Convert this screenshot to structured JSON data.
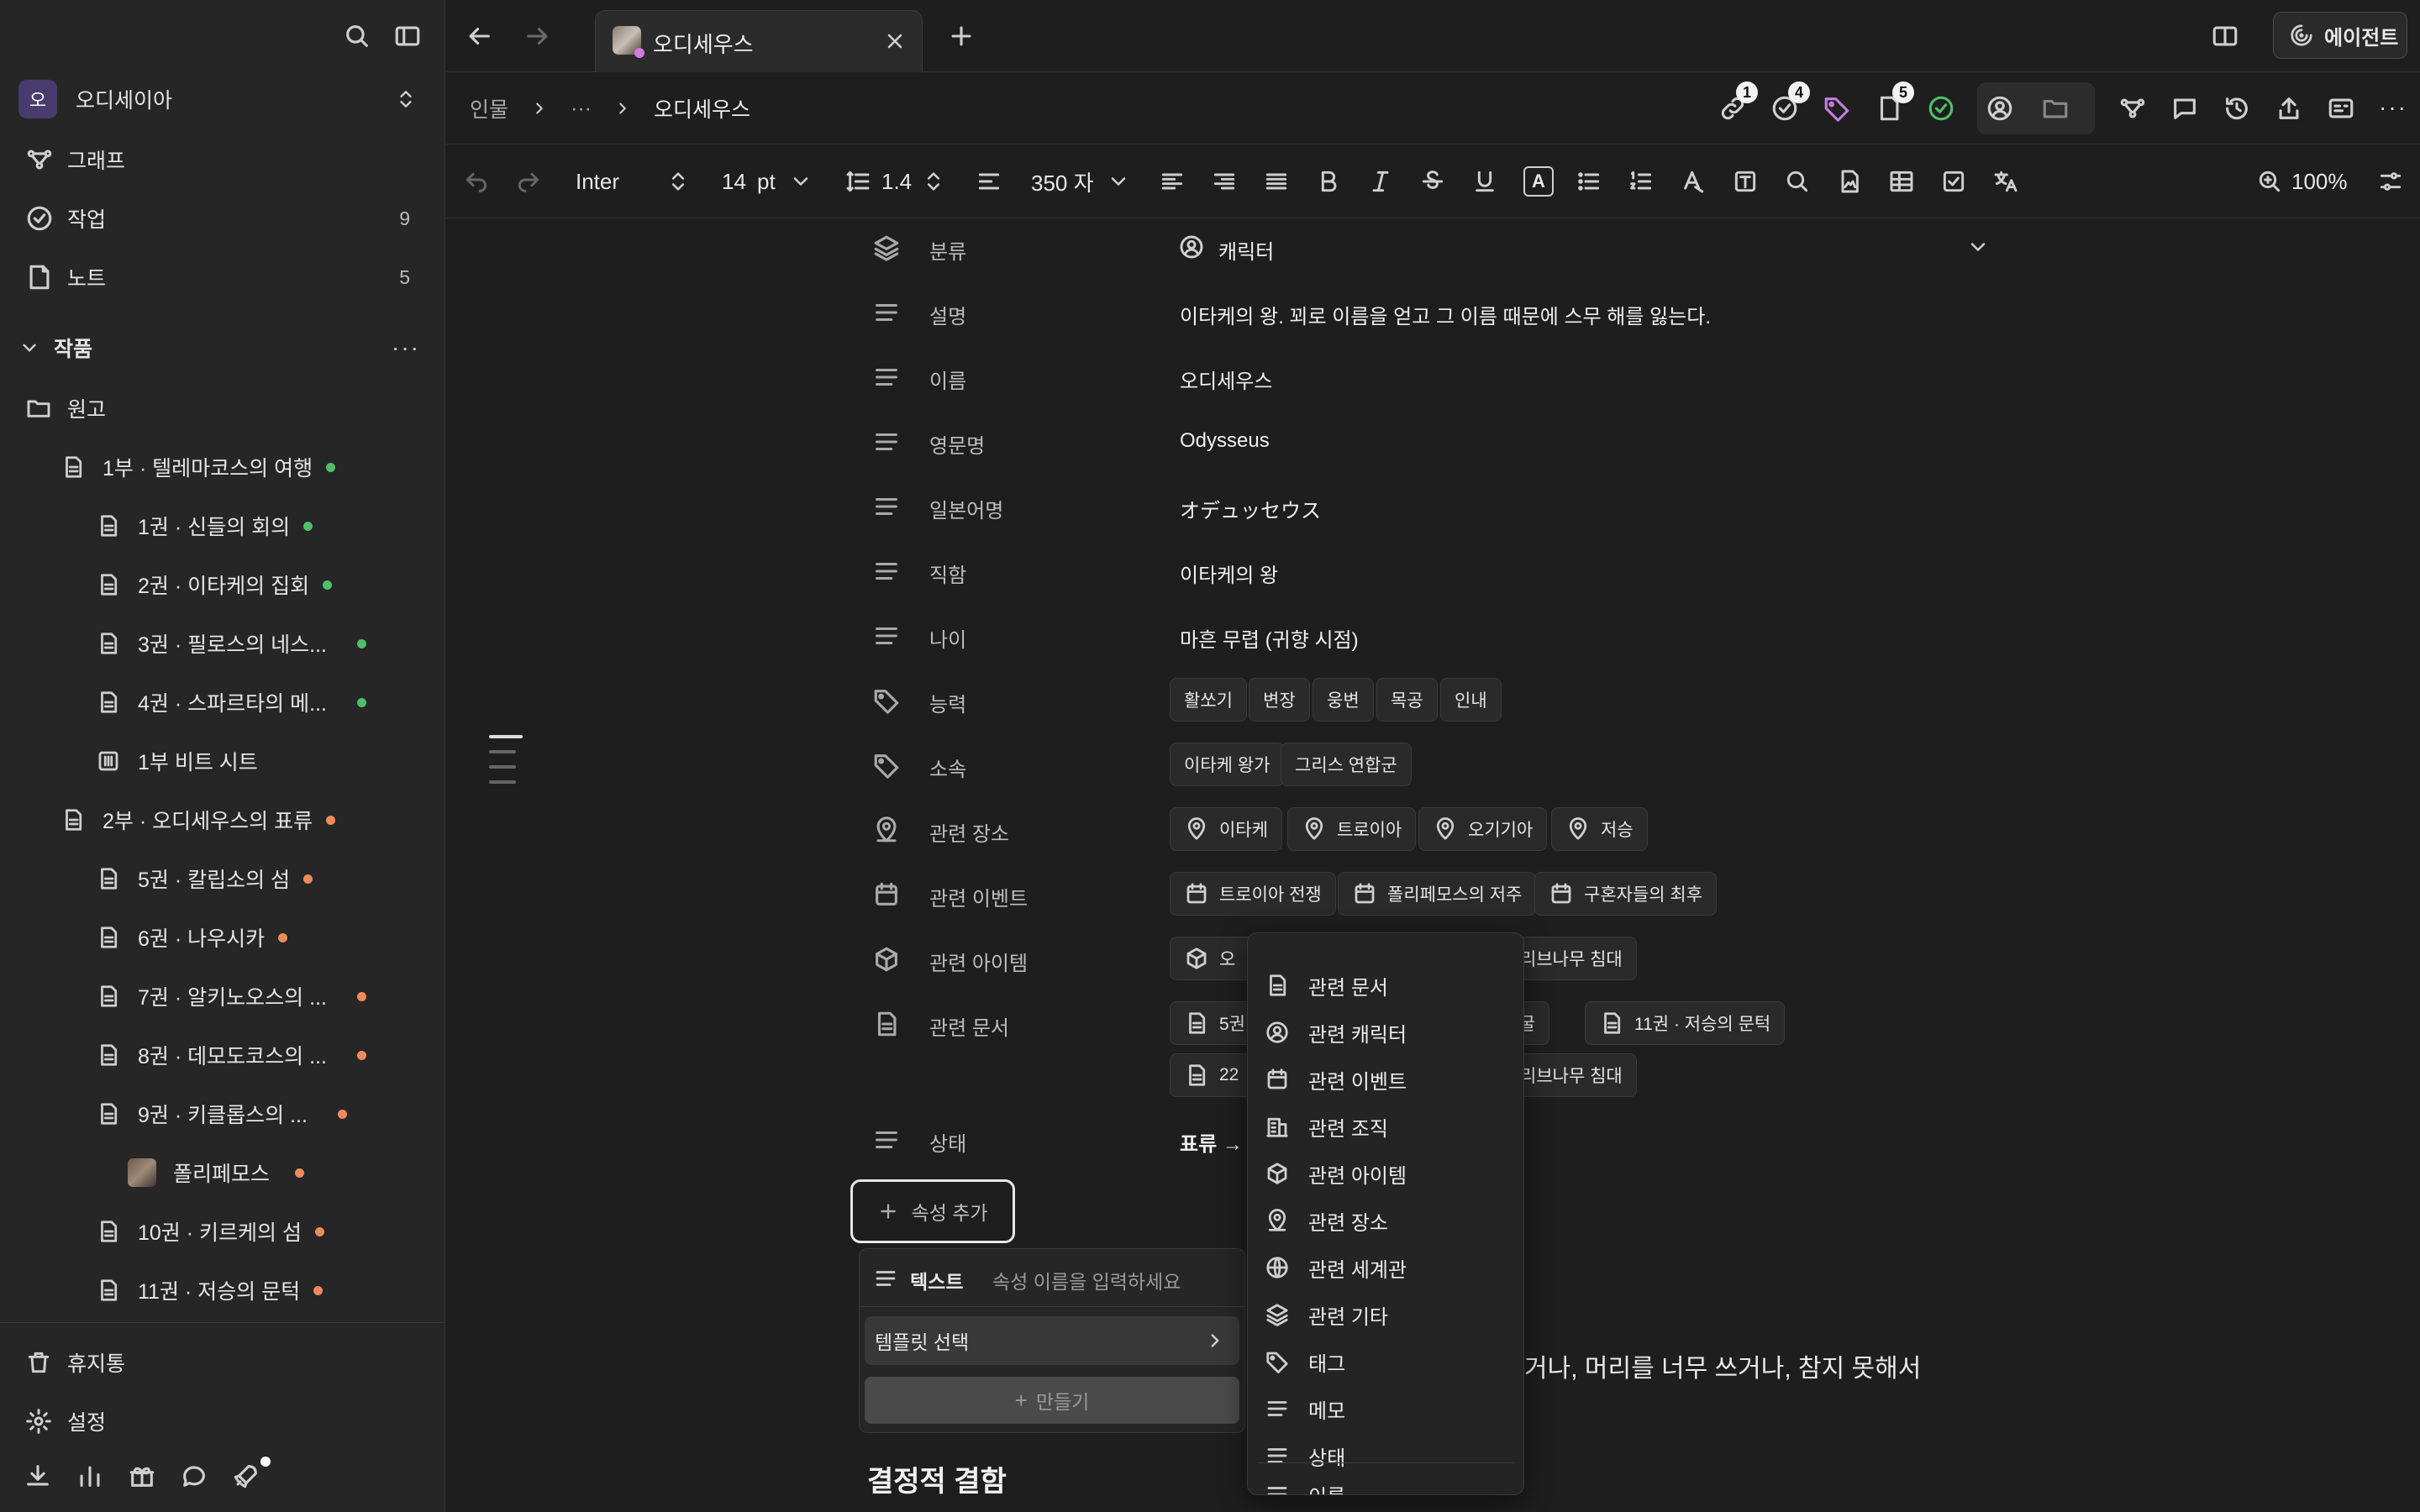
{
  "sidebar": {
    "workspace": "오디세이아",
    "workspace_initial": "오",
    "nav": [
      {
        "label": "그래프",
        "count": ""
      },
      {
        "label": "작업",
        "count": "9"
      },
      {
        "label": "노트",
        "count": "5"
      }
    ],
    "section_title": "작품",
    "folder": "원고",
    "tree": [
      "1부 · 텔레마코스의 여행",
      "1권 · 신들의 회의",
      "2권 · 이타케의 집회",
      "3권 · 필로스의 네스...",
      "4권 · 스파르타의 메...",
      "1부 비트 시트",
      "2부 · 오디세우스의 표류",
      "5권 · 칼립소의 섬",
      "6권 · 나우시카",
      "7권 · 알키노오스의 ...",
      "8권 · 데모도코스의 ...",
      "9권 · 키클롭스의 ...",
      "폴리페모스",
      "10권 · 키르케의 섬",
      "11권 · 저승의 문턱"
    ],
    "bottom": [
      "휴지통",
      "설정"
    ]
  },
  "tab": {
    "title": "오디세우스"
  },
  "agent_button": "에이전트",
  "breadcrumb": {
    "root": "인물",
    "ellipsis": "···",
    "current": "오디세우스"
  },
  "badges": {
    "links": "1",
    "tasks": "4",
    "docs": "5"
  },
  "toolbar": {
    "font": "Inter",
    "size": "14",
    "unit": "pt",
    "line_height": "1.4",
    "width": "350 자",
    "zoom": "100%"
  },
  "properties": [
    {
      "label": "분류",
      "value": "캐릭터"
    },
    {
      "label": "설명",
      "value": "이타케의 왕. 꾀로 이름을 얻고 그 이름 때문에 스무 해를 잃는다."
    },
    {
      "label": "이름",
      "value": "오디세우스"
    },
    {
      "label": "영문명",
      "value": "Odysseus"
    },
    {
      "label": "일본어명",
      "value": "オデュッセウス"
    },
    {
      "label": "직함",
      "value": "이타케의 왕"
    },
    {
      "label": "나이",
      "value": "마흔 무렵 (귀향 시점)"
    },
    {
      "label": "능력",
      "value": ""
    },
    {
      "label": "소속",
      "value": ""
    },
    {
      "label": "관련 장소",
      "value": ""
    },
    {
      "label": "관련 이벤트",
      "value": ""
    },
    {
      "label": "관련 아이템",
      "value": ""
    },
    {
      "label": "관련 문서",
      "value": ""
    },
    {
      "label": "상태",
      "value": "표류 →"
    }
  ],
  "abilities": [
    "활쏘기",
    "변장",
    "웅변",
    "목공",
    "인내"
  ],
  "affiliations": [
    "이타케 왕가",
    "그리스 연합군"
  ],
  "places": [
    "이타케",
    "트로이아",
    "오기기아",
    "저승"
  ],
  "events": [
    "트로이아 전쟁",
    "폴리페모스의 저주",
    "구혼자들의 최후"
  ],
  "items_partial": {
    "first": "오",
    "second": "리브나무 침대"
  },
  "docs_partial": {
    "first": "5권",
    "second": "| 동굴",
    "third": "11권 · 저승의 문턱",
    "row2_first": "22",
    "row2_second": "리브나무 침대"
  },
  "add_property": "속성 추가",
  "new_prop": {
    "type": "텍스트",
    "placeholder": "속성 이름을 입력하세요",
    "template": "템플릿 선택",
    "create": "만들기"
  },
  "relation_menu": [
    "관련 문서",
    "관련 캐릭터",
    "관련 이벤트",
    "관련 조직",
    "관련 아이템",
    "관련 장소",
    "관련 세계관",
    "관련 기타",
    "태그",
    "메모",
    "상태",
    "이름"
  ],
  "body_text": "거나, 머리를 너무 쓰거나, 참지 못해서",
  "heading": "결정적 결함"
}
